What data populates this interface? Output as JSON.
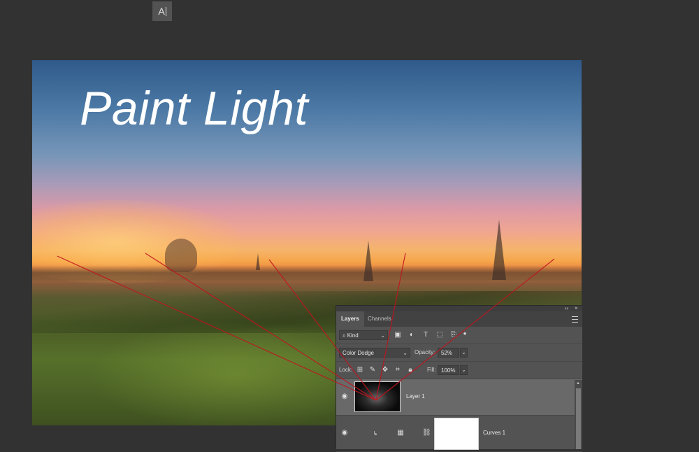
{
  "toolbar": {
    "type_tool_label": "A"
  },
  "canvas": {
    "title": "Paint Light"
  },
  "panel": {
    "collapse_glyph": "‹‹",
    "close_glyph": "×",
    "tabs": [
      {
        "label": "Layers",
        "active": true
      },
      {
        "label": "Channels",
        "active": false
      }
    ],
    "filter": {
      "search_glyph": "⌕",
      "value": "Kind",
      "chevron": "⌄"
    },
    "blend": {
      "mode": "Color Dodge",
      "opacity_label": "Opacity:",
      "opacity_value": "52%"
    },
    "lock": {
      "label": "Lock:",
      "fill_label": "Fill:",
      "fill_value": "100%"
    },
    "layers": [
      {
        "name": "Layer 1",
        "selected": true
      },
      {
        "name": "Curves 1",
        "selected": false
      }
    ]
  },
  "colors": {
    "rays": "#c0141e",
    "panel_bg": "#535353",
    "selected_row": "#696969",
    "app_bg": "#323232"
  }
}
